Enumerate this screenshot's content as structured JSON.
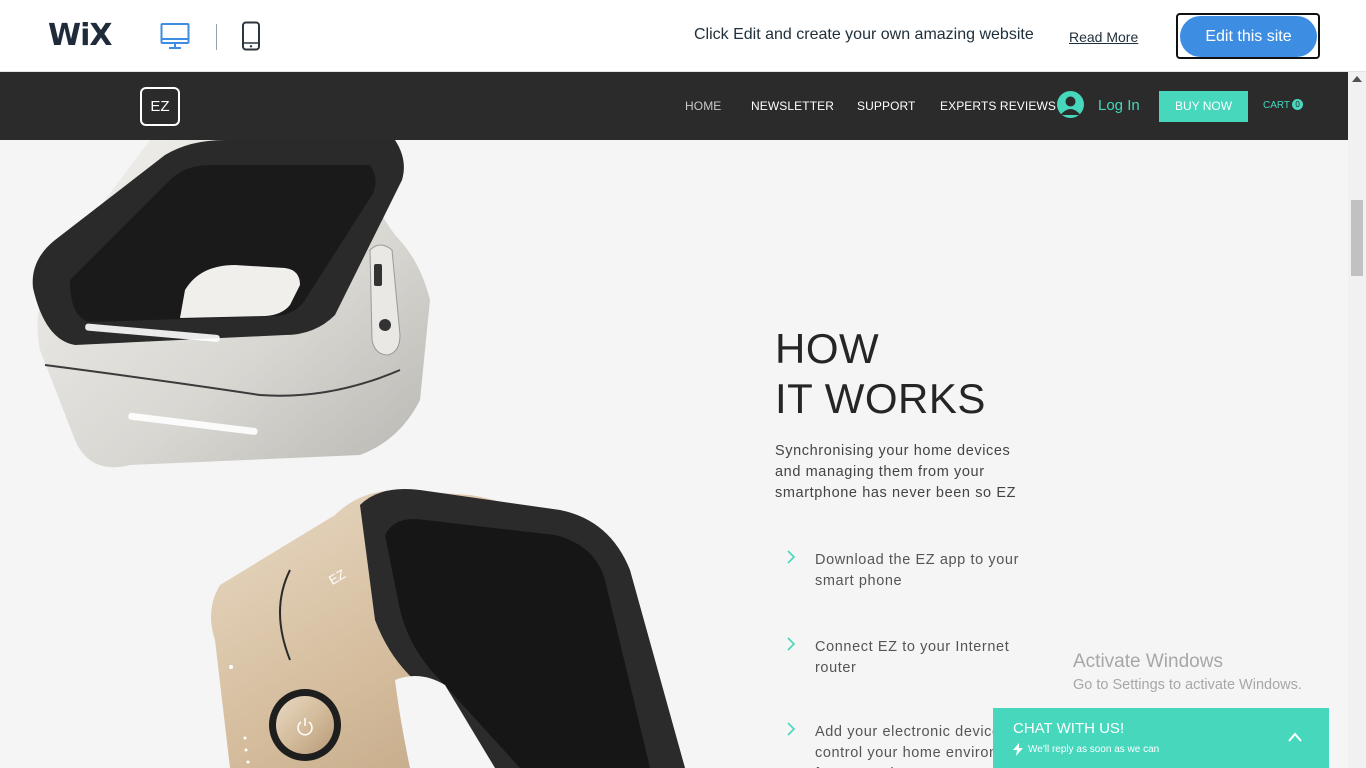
{
  "wix_bar": {
    "logo": "WiX",
    "promo_text": "Click Edit and create your own amazing website",
    "read_more": "Read More",
    "edit_button": "Edit this site"
  },
  "site_header": {
    "logo": "EZ",
    "nav": [
      "HOME",
      "NEWSLETTER",
      "SUPPORT",
      "EXPERTS REVIEWS"
    ],
    "active_nav": "HOME",
    "login": "Log In",
    "buy_now": "BUY NOW",
    "cart_label": "CART",
    "cart_count": "0"
  },
  "how_it_works": {
    "title_line1": "HOW",
    "title_line2": "IT WORKS",
    "description": "Synchronising your home devices and managing them from your smartphone has never been so EZ",
    "steps": [
      "Download the EZ app to your smart phone",
      "Connect EZ to your Internet router",
      "Add your electronic devices and control your home environment from one place"
    ]
  },
  "product": {
    "device_logo": "EZ"
  },
  "watermark": {
    "title": "Activate Windows",
    "subtitle": "Go to Settings to activate Windows."
  },
  "chat": {
    "title": "CHAT WITH US!",
    "subtitle": "We'll reply as soon as we can"
  },
  "colors": {
    "accent": "#46d7bd",
    "header_bg": "#2b2b2b",
    "edit_button": "#3d8ee3",
    "page_bg": "#f5f5f5"
  },
  "icons": [
    "desktop-icon",
    "mobile-icon",
    "user-avatar-icon",
    "chevron-right-icon",
    "lightning-icon",
    "chevron-up-icon",
    "power-icon"
  ]
}
